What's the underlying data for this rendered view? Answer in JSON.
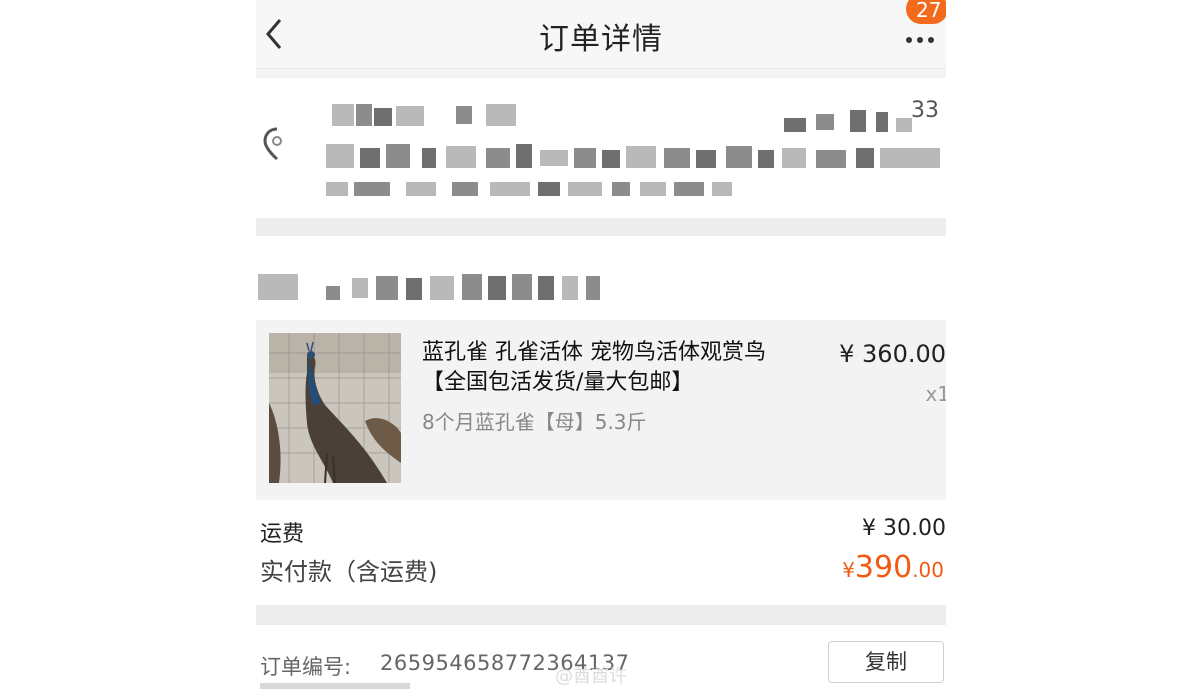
{
  "header": {
    "title": "订单详情",
    "badge_count": "27"
  },
  "address": {
    "phone_suffix": "33"
  },
  "product": {
    "title": "蓝孔雀 孔雀活体 宠物鸟活体观赏鸟【全国包活发货/量大包邮】",
    "spec": "8个月蓝孔雀【母】5.3斤",
    "price": "¥ 360.00",
    "quantity": "x1"
  },
  "totals": {
    "shipping_label": "运费",
    "shipping_value": "¥ 30.00",
    "paid_label": "实付款（含运费)",
    "paid_currency": "¥",
    "paid_integer": "390",
    "paid_decimal": ".00"
  },
  "order": {
    "number_label": "订单编号:",
    "number_value": "265954658772364137",
    "copy_label": "复制"
  },
  "watermark": "@酋酋许",
  "colors": {
    "accent": "#f25a14",
    "badge": "#f26b1d"
  }
}
